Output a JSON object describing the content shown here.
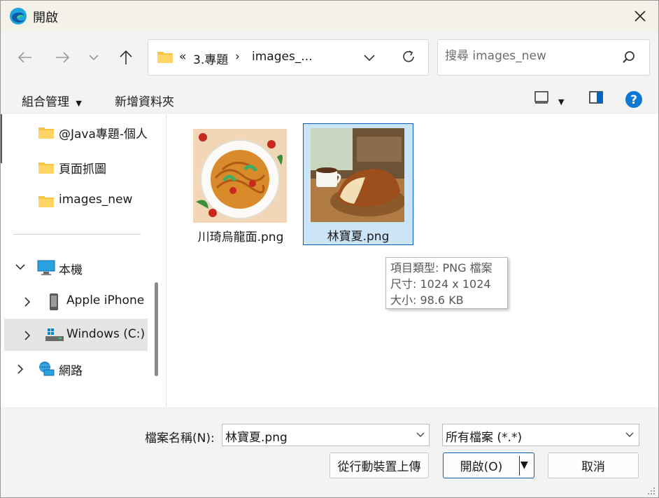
{
  "window": {
    "title": "開啟",
    "icon": "edge-icon"
  },
  "navigation": {
    "back_icon": "back-arrow-icon",
    "forward_icon": "forward-arrow-icon",
    "recent_icon": "chevron-down-icon",
    "up_icon": "up-arrow-icon"
  },
  "address": {
    "overflow": "«",
    "crumbs": [
      "3.專題",
      "images_..."
    ]
  },
  "search": {
    "placeholder": "搜尋 images_new"
  },
  "commandbar": {
    "organize": "組合管理",
    "new_folder": "新增資料夾"
  },
  "navpane": {
    "items": [
      {
        "label": "@Java專題-個人",
        "icon": "folder-icon"
      },
      {
        "label": "頁面抓圖",
        "icon": "folder-icon"
      },
      {
        "label": "images_new",
        "icon": "folder-icon"
      },
      {
        "label": "本機",
        "icon": "computer-icon",
        "expanded": true
      },
      {
        "label": "Apple iPhone",
        "icon": "phone-icon"
      },
      {
        "label": "Windows (C:)",
        "icon": "drive-icon",
        "selected": true
      },
      {
        "label": "網路",
        "icon": "network-icon"
      }
    ]
  },
  "files": [
    {
      "name": "川琦烏龍面.png",
      "thumb": "noodle-bowl-thumbnail",
      "selected": false
    },
    {
      "name": "林寶夏.png",
      "thumb": "bread-coffee-thumbnail",
      "selected": true
    }
  ],
  "tooltip": {
    "lines": [
      "項目類型: PNG 檔案",
      "尺寸: 1024 x 1024",
      "大小: 98.6 KB"
    ]
  },
  "footer": {
    "filename_label": "檔案名稱(N):",
    "filename_value": "林寶夏.png",
    "filetype_value": "所有檔案 (*.*)",
    "upload_button": "從行動裝置上傳",
    "open_button": "開啟(O)",
    "cancel_button": "取消"
  },
  "colors": {
    "accent": "#0067c0",
    "selection": "#cce4f7",
    "title_bar": "#f3f1e8"
  }
}
